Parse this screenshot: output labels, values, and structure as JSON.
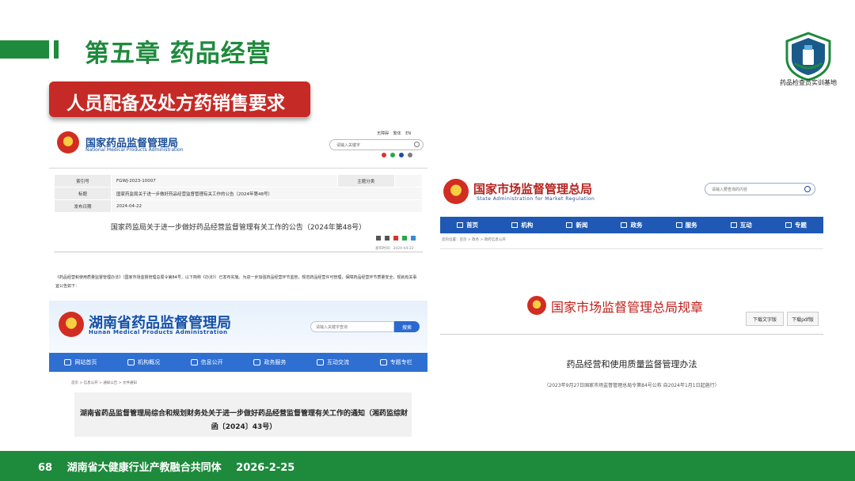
{
  "header": {
    "chapter_title": "第五章  药品经营",
    "section_banner": "人员配备及处方药销售要求",
    "logo_caption": "药品检查员实训基地"
  },
  "nmpa": {
    "name": "国家药品监督管理局",
    "name_en": "National Medical Products Administration",
    "top_links": [
      "无障碍",
      "繁体",
      "EN"
    ],
    "search_placeholder": "请输入关键字",
    "meta": [
      {
        "key": "索引号",
        "value": "FGWJ-2023-10007",
        "key2": "主题分类",
        "value2": ""
      },
      {
        "key": "标题",
        "value": "国家药监局关于进一步做好药品经营监督管理有关工作的公告（2024年第48号）"
      },
      {
        "key": "发布日期",
        "value": "2024-04-22"
      }
    ],
    "notice_title": "国家药监局关于进一步做好药品经营监督管理有关工作的公告（2024年第48号）",
    "pub_date": "发布时间：2024-04-22",
    "body": "《药品经营和使用质量监督管理办法》（国家市场监督管理总局令第84号，以下简称《办法》）已发布实施。为进一步加强药品经营环节监管，规范药品经营许可管理，保障药品经营环节质量安全，现就有关事宜公告如下："
  },
  "hunan": {
    "name": "湖南省药品监督管理局",
    "name_en": "Hunan Medical Products Administration",
    "search_placeholder": "请输入关键字查询",
    "search_button": "搜索",
    "nav": [
      "网站首页",
      "机构概况",
      "信息公开",
      "政务服务",
      "互动交流",
      "专题专栏"
    ],
    "breadcrumb": "首页 > 信息公开 > 通知公告 > 文件通知",
    "doc_title": "湖南省药品监督管理局综合和规划财务处关于进一步做好药品经营监督管理有关工作的通知（湘药监综财函〔2024〕43号）"
  },
  "samr": {
    "name": "国家市场监督管理总局",
    "name_en": "State Administration for Market Regulation",
    "search_placeholder": "请输入要查询的内容",
    "nav": [
      "首页",
      "机构",
      "新闻",
      "政务",
      "服务",
      "互动",
      "专题"
    ],
    "breadcrumb": "您的位置：首页 > 政务 > 政府信息公开",
    "rule_title": "国家市场监督管理总局规章",
    "download_word": "下载文字版",
    "download_pdf": "下载pdf版",
    "law_title": "药品经营和使用质量监督管理办法",
    "law_subtitle": "（2023年9月27日国家市场监督管理总局令第84号公布 自2024年1月1日起施行）"
  },
  "footer": {
    "page_number": "68",
    "organization": "湖南省大健康行业产教融合共同体",
    "date": "2026-2-25"
  },
  "colors": {
    "brand_green": "#1e8a3c",
    "banner_red": "#c62a26",
    "nmpa_blue": "#1a4f9c",
    "samr_red": "#b3231f",
    "samr_nav_blue": "#1f59b5",
    "hunan_nav_blue": "#2f6fd1"
  }
}
